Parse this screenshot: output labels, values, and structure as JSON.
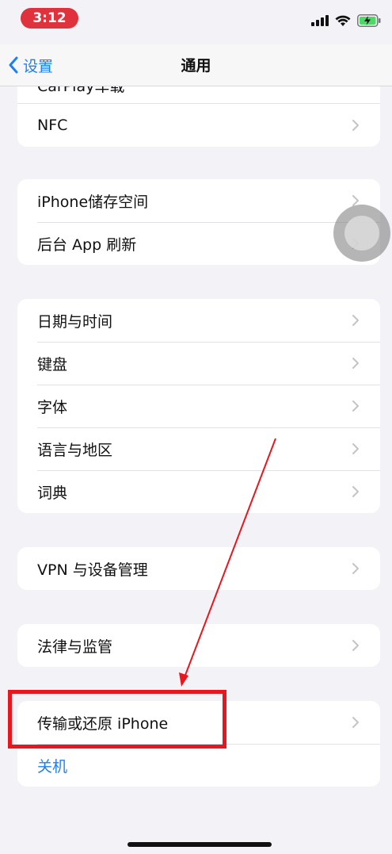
{
  "status_bar": {
    "time": "3:12"
  },
  "nav": {
    "back_label": "设置",
    "title": "通用"
  },
  "groups": [
    {
      "id": "group-1",
      "partial": "CarPlay车载",
      "rows": [
        {
          "label": "NFC"
        }
      ]
    },
    {
      "id": "group-2",
      "rows": [
        {
          "label": "iPhone储存空间"
        },
        {
          "label": "后台 App 刷新"
        }
      ]
    },
    {
      "id": "group-3",
      "rows": [
        {
          "label": "日期与时间"
        },
        {
          "label": "键盘"
        },
        {
          "label": "字体"
        },
        {
          "label": "语言与地区"
        },
        {
          "label": "词典"
        }
      ]
    },
    {
      "id": "group-4",
      "rows": [
        {
          "label": "VPN 与设备管理"
        }
      ]
    },
    {
      "id": "group-5",
      "rows": [
        {
          "label": "法律与监管"
        }
      ]
    },
    {
      "id": "group-6",
      "rows": [
        {
          "label": "传输或还原 iPhone"
        },
        {
          "label": "关机"
        }
      ]
    }
  ],
  "colors": {
    "accent": "#1f7ff0",
    "highlight": "#e8161f",
    "time_pill": "#e0323c",
    "battery": "#4cd964"
  },
  "icons": {
    "back": "chevron-left-icon",
    "row_chevron": "chevron-right-icon",
    "signal": "cellular-signal-icon",
    "wifi": "wifi-icon",
    "battery": "battery-charging-icon"
  }
}
